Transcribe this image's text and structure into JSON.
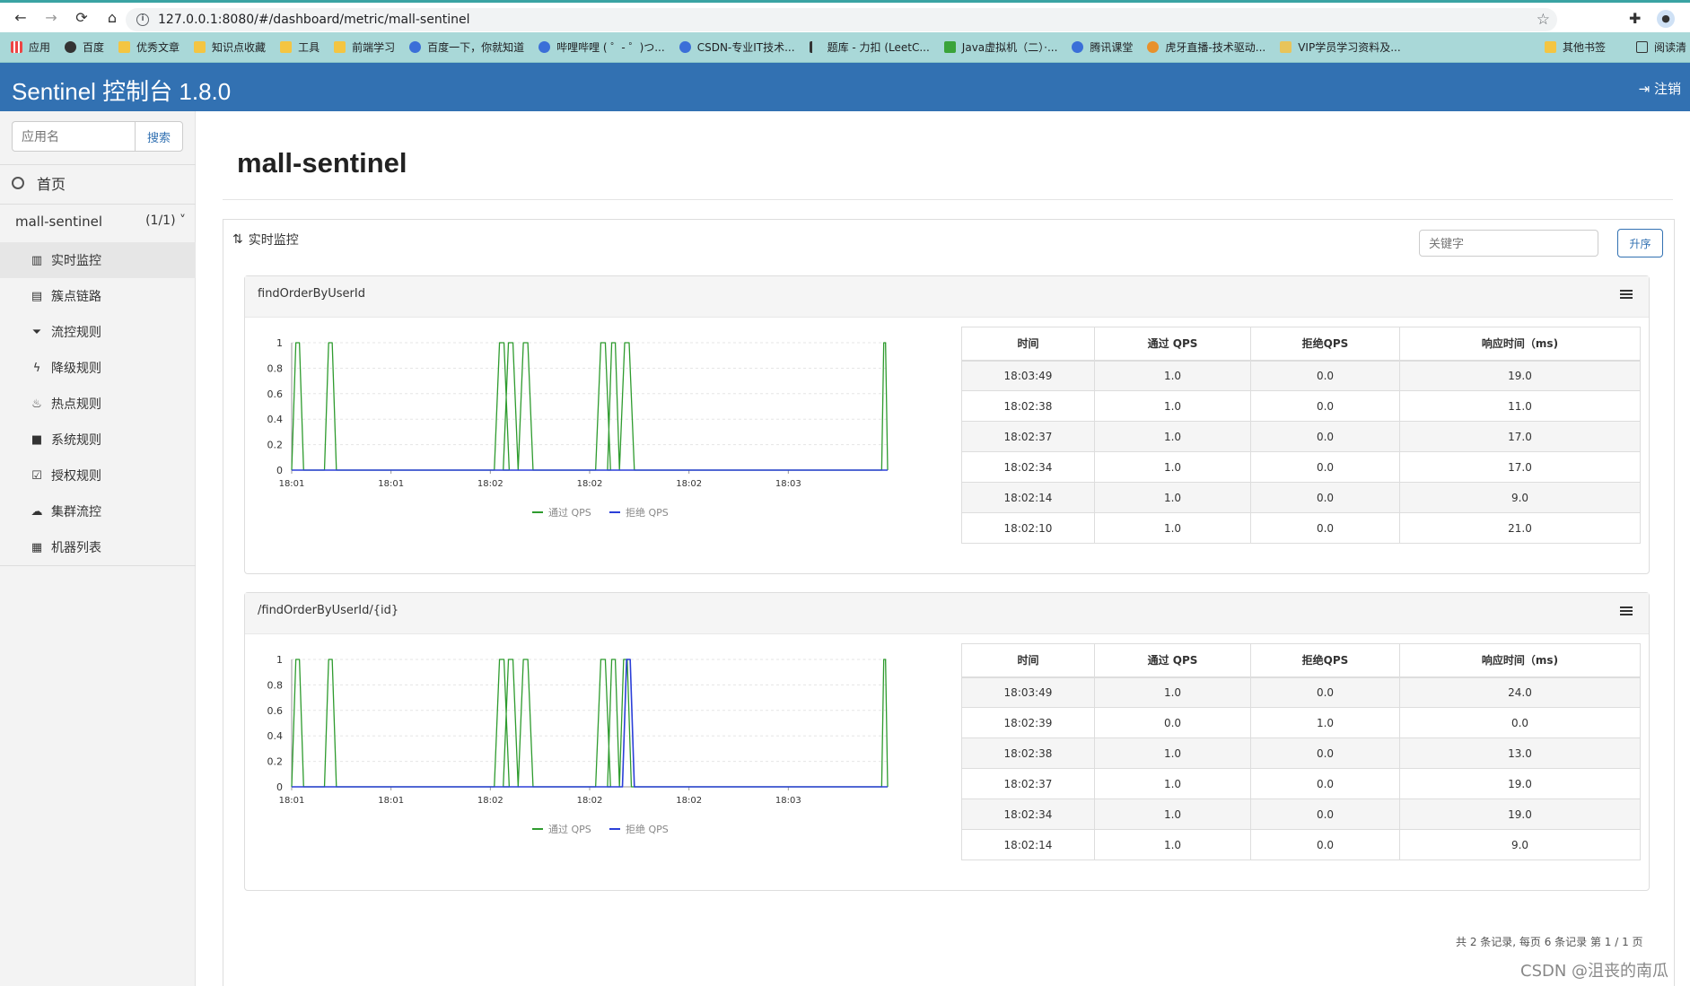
{
  "browser": {
    "url": "127.0.0.1:8080/#/dashboard/metric/mall-sentinel",
    "bookmarks": [
      "应用",
      "百度",
      "优秀文章",
      "知识点收藏",
      "工具",
      "前端学习",
      "百度一下，你就知道",
      "哔哩哔哩 ( ゜- ゜)つ...",
      "CSDN-专业IT技术...",
      "题库 - 力扣 (LeetC...",
      "Java虚拟机（二）·...",
      "腾讯课堂",
      "虎牙直播-技术驱动...",
      "VIP学员学习资料及..."
    ],
    "other_bookmarks": "其他书签",
    "reading_list": "阅读清"
  },
  "header": {
    "title": "Sentinel 控制台 1.8.0",
    "logout": "注销"
  },
  "sidebar": {
    "search_placeholder": "应用名",
    "search_button": "搜索",
    "home": "首页",
    "app_name": "mall-sentinel",
    "app_count": "(1/1)",
    "menu": [
      "实时监控",
      "簇点链路",
      "流控规则",
      "降级规则",
      "热点规则",
      "系统规则",
      "授权规则",
      "集群流控",
      "机器列表"
    ]
  },
  "main": {
    "page_title": "mall-sentinel",
    "panel_title": "实时监控",
    "keyword_placeholder": "关键字",
    "sort_button": "升序",
    "pager": "共 2 条记录, 每页 6 条记录 第 1 / 1 页"
  },
  "table_headers": [
    "时间",
    "通过 QPS",
    "拒绝QPS",
    "响应时间（ms)"
  ],
  "resources": [
    {
      "name": "findOrderByUserId",
      "rows": [
        [
          "18:03:49",
          "1.0",
          "0.0",
          "19.0"
        ],
        [
          "18:02:38",
          "1.0",
          "0.0",
          "11.0"
        ],
        [
          "18:02:37",
          "1.0",
          "0.0",
          "17.0"
        ],
        [
          "18:02:34",
          "1.0",
          "0.0",
          "17.0"
        ],
        [
          "18:02:14",
          "1.0",
          "0.0",
          "9.0"
        ],
        [
          "18:02:10",
          "1.0",
          "0.0",
          "21.0"
        ]
      ]
    },
    {
      "name": "/findOrderByUserId/{id}",
      "rows": [
        [
          "18:03:49",
          "1.0",
          "0.0",
          "24.0"
        ],
        [
          "18:02:39",
          "0.0",
          "1.0",
          "0.0"
        ],
        [
          "18:02:38",
          "1.0",
          "0.0",
          "13.0"
        ],
        [
          "18:02:37",
          "1.0",
          "0.0",
          "19.0"
        ],
        [
          "18:02:34",
          "1.0",
          "0.0",
          "19.0"
        ],
        [
          "18:02:14",
          "1.0",
          "0.0",
          "9.0"
        ]
      ]
    }
  ],
  "chart_data": [
    {
      "type": "line",
      "title": "",
      "x_ticks": [
        "18:01",
        "18:01",
        "18:02",
        "18:02",
        "18:02",
        "18:03"
      ],
      "y_ticks": [
        "0",
        "0.2",
        "0.4",
        "0.6",
        "0.8",
        "1"
      ],
      "ylim": [
        0,
        1
      ],
      "grid": true,
      "legend": "bottom",
      "series": [
        {
          "name": "通过 QPS",
          "color": "#2e9b2e",
          "spikes": [
            [
              0.0,
              0.02
            ],
            [
              0.055,
              0.075
            ],
            [
              0.34,
              0.365
            ],
            [
              0.355,
              0.38
            ],
            [
              0.38,
              0.405
            ],
            [
              0.51,
              0.535
            ],
            [
              0.53,
              0.55
            ],
            [
              0.55,
              0.575
            ],
            [
              0.99,
              1.0
            ]
          ]
        },
        {
          "name": "拒绝 QPS",
          "color": "#2b3fd8",
          "spikes": []
        }
      ]
    },
    {
      "type": "line",
      "title": "",
      "x_ticks": [
        "18:01",
        "18:01",
        "18:02",
        "18:02",
        "18:02",
        "18:03"
      ],
      "y_ticks": [
        "0",
        "0.2",
        "0.4",
        "0.6",
        "0.8",
        "1"
      ],
      "ylim": [
        0,
        1
      ],
      "grid": true,
      "legend": "bottom",
      "series": [
        {
          "name": "通过 QPS",
          "color": "#2e9b2e",
          "spikes": [
            [
              0.0,
              0.02
            ],
            [
              0.055,
              0.075
            ],
            [
              0.34,
              0.365
            ],
            [
              0.355,
              0.38
            ],
            [
              0.38,
              0.405
            ],
            [
              0.51,
              0.535
            ],
            [
              0.53,
              0.55
            ],
            [
              0.55,
              0.57
            ],
            [
              0.99,
              1.0
            ]
          ]
        },
        {
          "name": "拒绝 QPS",
          "color": "#2b3fd8",
          "spikes": [
            [
              0.555,
              0.575
            ]
          ]
        }
      ]
    }
  ],
  "watermark": "CSDN @沮丧的南瓜"
}
